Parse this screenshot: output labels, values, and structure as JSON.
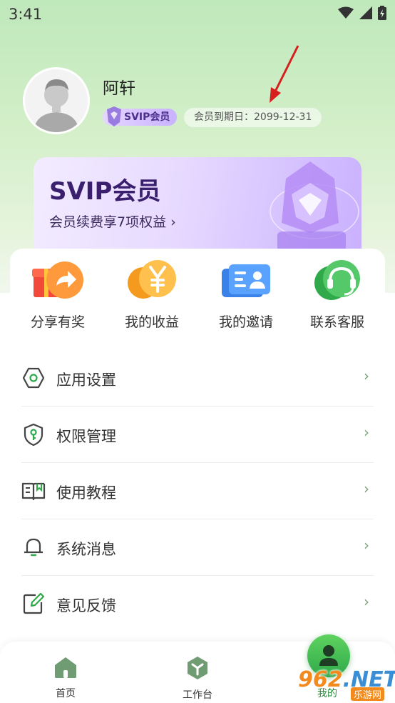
{
  "status_bar": {
    "time": "3:41"
  },
  "profile": {
    "name": "阿轩",
    "badge": "SVIP会员",
    "expiry": "会员到期日：2099-12-31"
  },
  "vip_card": {
    "title": "SVIP会员",
    "subtitle": "会员续费享7项权益 ›"
  },
  "shortcuts": [
    {
      "label": "分享有奖",
      "icon": "gift-share-icon"
    },
    {
      "label": "我的收益",
      "icon": "coin-yen-icon"
    },
    {
      "label": "我的邀请",
      "icon": "invite-card-icon"
    },
    {
      "label": "联系客服",
      "icon": "headset-icon"
    }
  ],
  "menu": [
    {
      "label": "应用设置",
      "icon": "settings-hexagon-icon",
      "chevron": "›"
    },
    {
      "label": "权限管理",
      "icon": "shield-key-icon",
      "chevron": "›"
    },
    {
      "label": "使用教程",
      "icon": "book-icon",
      "chevron": "›"
    },
    {
      "label": "系统消息",
      "icon": "bell-icon",
      "chevron": "›"
    },
    {
      "label": "意见反馈",
      "icon": "edit-icon",
      "chevron": "›"
    }
  ],
  "tabbar": {
    "home": "首页",
    "workbench": "工作台",
    "mine": "我的"
  },
  "watermark": {
    "main_a": "962",
    "main_b": ".NET",
    "sub": "乐游网"
  },
  "colors": {
    "accent_green": "#2fa94a",
    "vip_purple": "#3a1f6e",
    "bg_green": "#bfe8bb"
  }
}
